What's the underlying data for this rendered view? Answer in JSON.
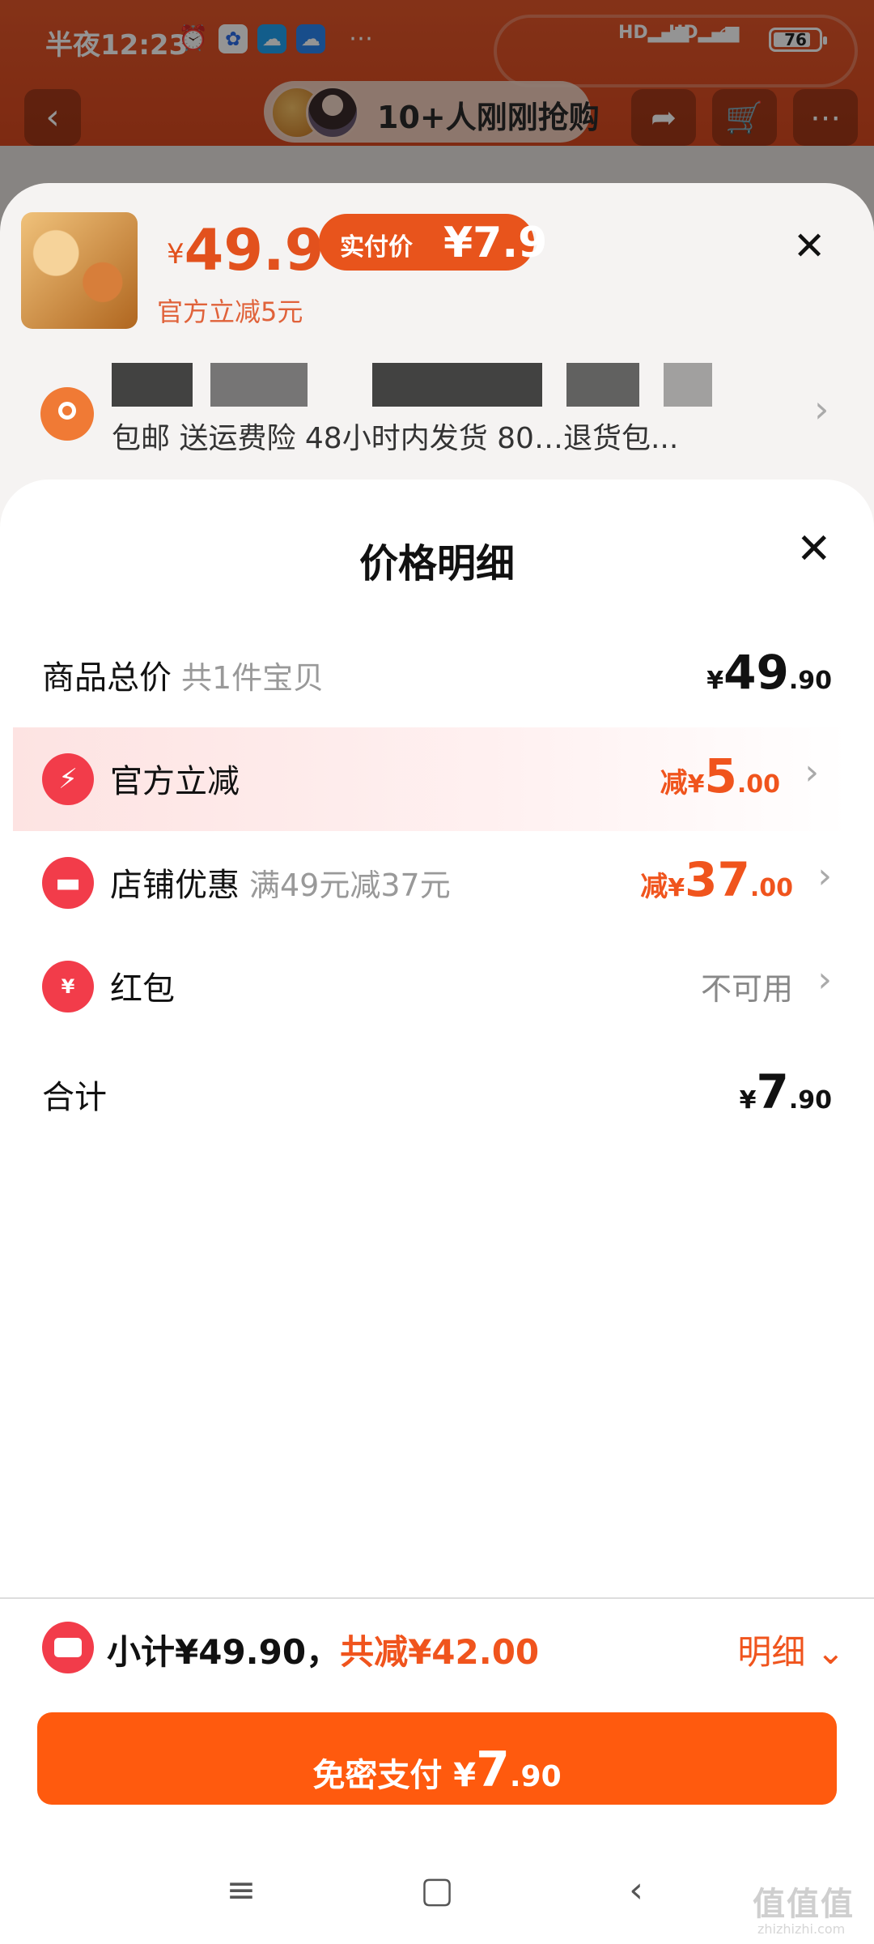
{
  "status_bar": {
    "time": "半夜12:23",
    "network_1": "HD",
    "network_2": "HD",
    "battery": "76"
  },
  "background_page": {
    "buyers_text": "10+人刚刚抢购"
  },
  "product_sheet": {
    "price_symbol": "¥",
    "price": "49.9",
    "paid_label": "实付价",
    "paid_value": "¥7.9",
    "discount_note": "官方立减5元",
    "delivery_info": "包邮 送运费险 48小时内发货 80…退货包..."
  },
  "price_detail": {
    "title": "价格明细",
    "rows": [
      {
        "label": "商品总价",
        "sub": "共1件宝贝",
        "yen": "¥",
        "int": "49",
        "dec": ".90"
      },
      {
        "label": "官方立减",
        "prefix": "减",
        "yen": "¥",
        "int": "5",
        "dec": ".00",
        "icon": "lightning-icon"
      },
      {
        "label": "店铺优惠",
        "sub": "满49元减37元",
        "prefix": "减",
        "yen": "¥",
        "int": "37",
        "dec": ".00",
        "icon": "shop-icon"
      },
      {
        "label": "红包",
        "value": "不可用",
        "icon": "red-envelope-icon"
      },
      {
        "label": "合计",
        "yen": "¥",
        "int": "7",
        "dec": ".90"
      }
    ]
  },
  "summary": {
    "subtotal": "小计¥49.90，",
    "total_discount": "共减¥42.00",
    "detail_toggle": "明细"
  },
  "pay_button": {
    "label": "免密支付 ¥",
    "int": "7",
    "dec": ".90"
  },
  "watermark": {
    "text": "值值值",
    "sub": "zhizhizhi.com"
  },
  "colors": {
    "accent": "#ff5a0e",
    "discount": "#f0541d",
    "icon_red": "#f23c4a"
  }
}
